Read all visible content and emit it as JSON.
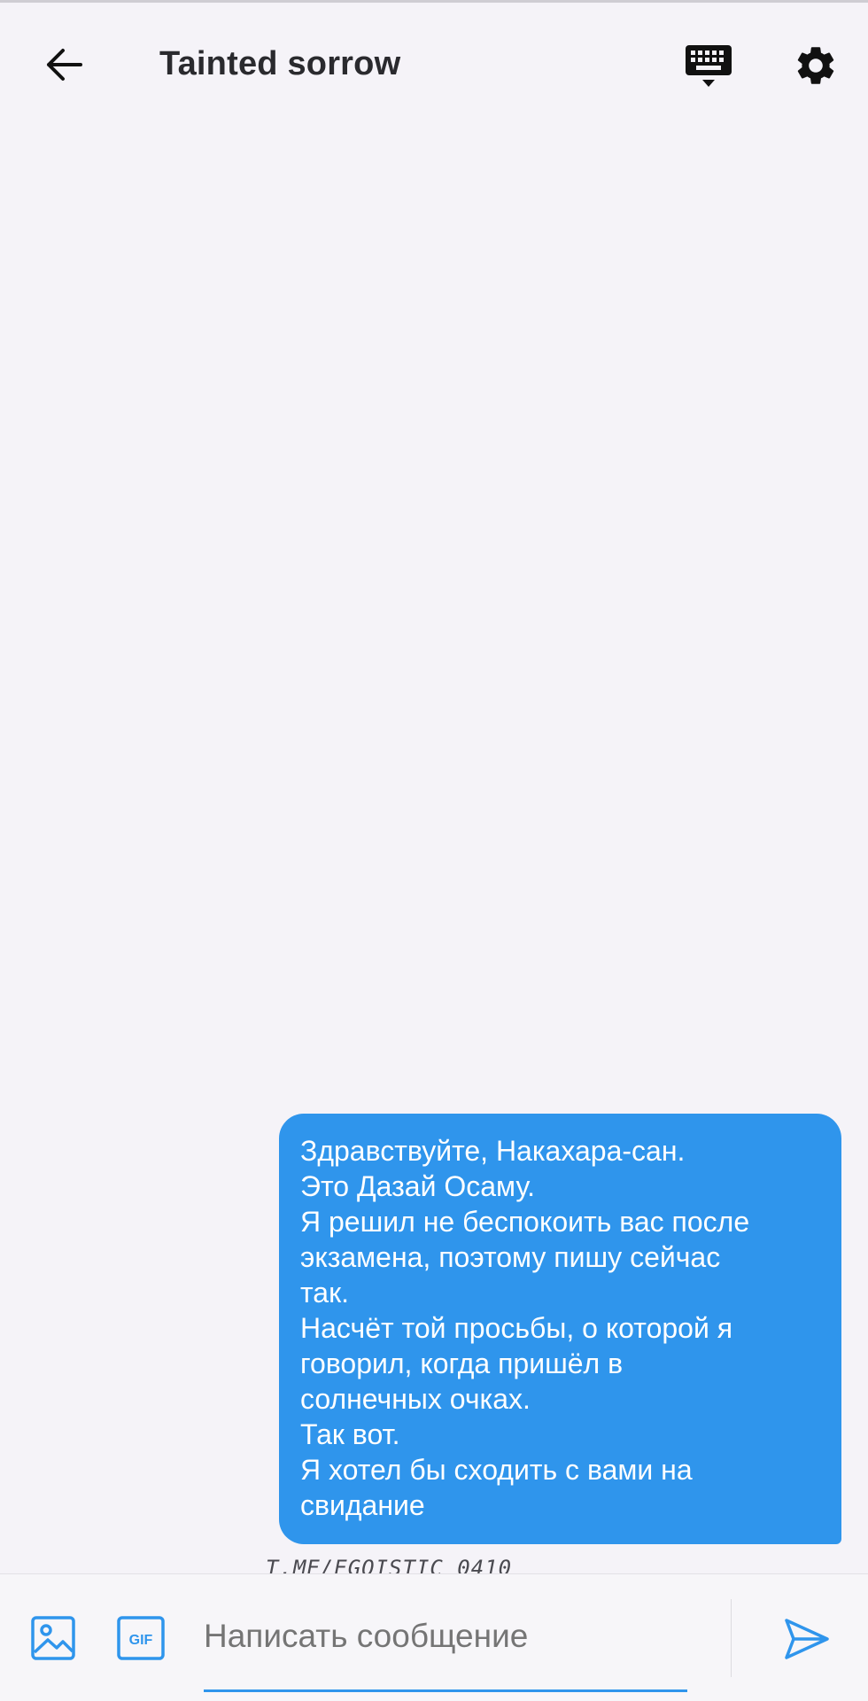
{
  "header": {
    "title": "Tainted sorrow",
    "icons": [
      "arrow-left-icon",
      "keyboard-icon",
      "gear-icon"
    ]
  },
  "message": {
    "lines": [
      "Здравствуйте, Накахара-сан.",
      "Это Дазай Осаму.",
      "Я решил не беспокоить вас после",
      "экзамена, поэтому пишу сейчас",
      "так.",
      "Насчёт той просьбы, о которой я",
      "говорил, когда пришёл в",
      "солнечных очках.",
      "Так вот.",
      "Я хотел бы сходить с вами на",
      "свидание"
    ],
    "bubble_color": "#2f95ec"
  },
  "watermark": "T.ME/EGOISTIC_0410",
  "composer": {
    "placeholder": "Написать сообщение",
    "gif_label": "GIF",
    "accent": "#2f95ec"
  }
}
